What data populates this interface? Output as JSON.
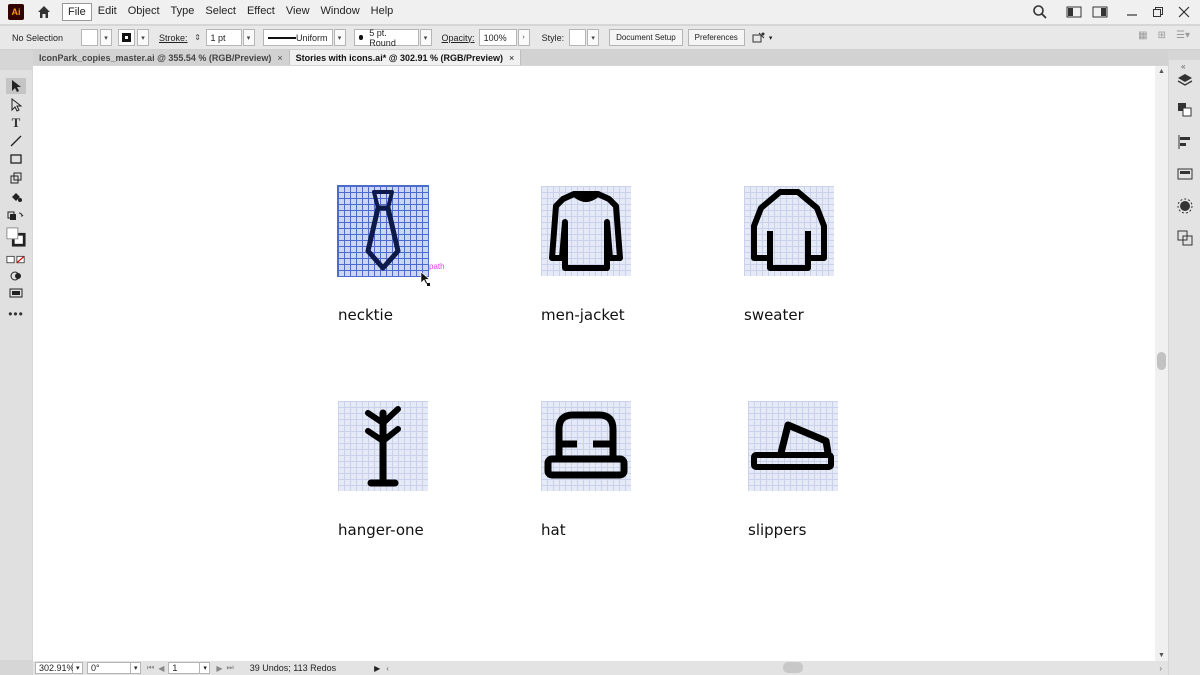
{
  "app": {
    "logo_text": "Ai"
  },
  "menu": [
    "File",
    "Edit",
    "Object",
    "Type",
    "Select",
    "Effect",
    "View",
    "Window",
    "Help"
  ],
  "control_bar": {
    "selection_status": "No Selection",
    "stroke_label": "Stroke:",
    "stroke_weight": "1 pt",
    "profile": "Uniform",
    "brush": "5 pt. Round",
    "opacity_label": "Opacity:",
    "opacity_value": "100%",
    "style_label": "Style:",
    "document_setup": "Document Setup",
    "preferences": "Preferences"
  },
  "tabs": [
    {
      "label": "IconPark_copies_master.ai @ 355.54 % (RGB/Preview)",
      "active": false
    },
    {
      "label": "Stories with icons.ai* @ 302.91 % (RGB/Preview)",
      "active": true
    }
  ],
  "canvas": {
    "icons": [
      {
        "name": "necktie",
        "selected": true
      },
      {
        "name": "men-jacket",
        "selected": false
      },
      {
        "name": "sweater",
        "selected": false
      },
      {
        "name": "hanger-one",
        "selected": false
      },
      {
        "name": "hat",
        "selected": false
      },
      {
        "name": "slippers",
        "selected": false
      }
    ],
    "path_hint": "path"
  },
  "status_bar": {
    "zoom": "302.91%",
    "rotation": "0°",
    "artboard": "1",
    "undo_info": "39 Undos; 113 Redos"
  },
  "colors": {
    "accent": "#4d6bc9",
    "hint": "#e040e0"
  }
}
